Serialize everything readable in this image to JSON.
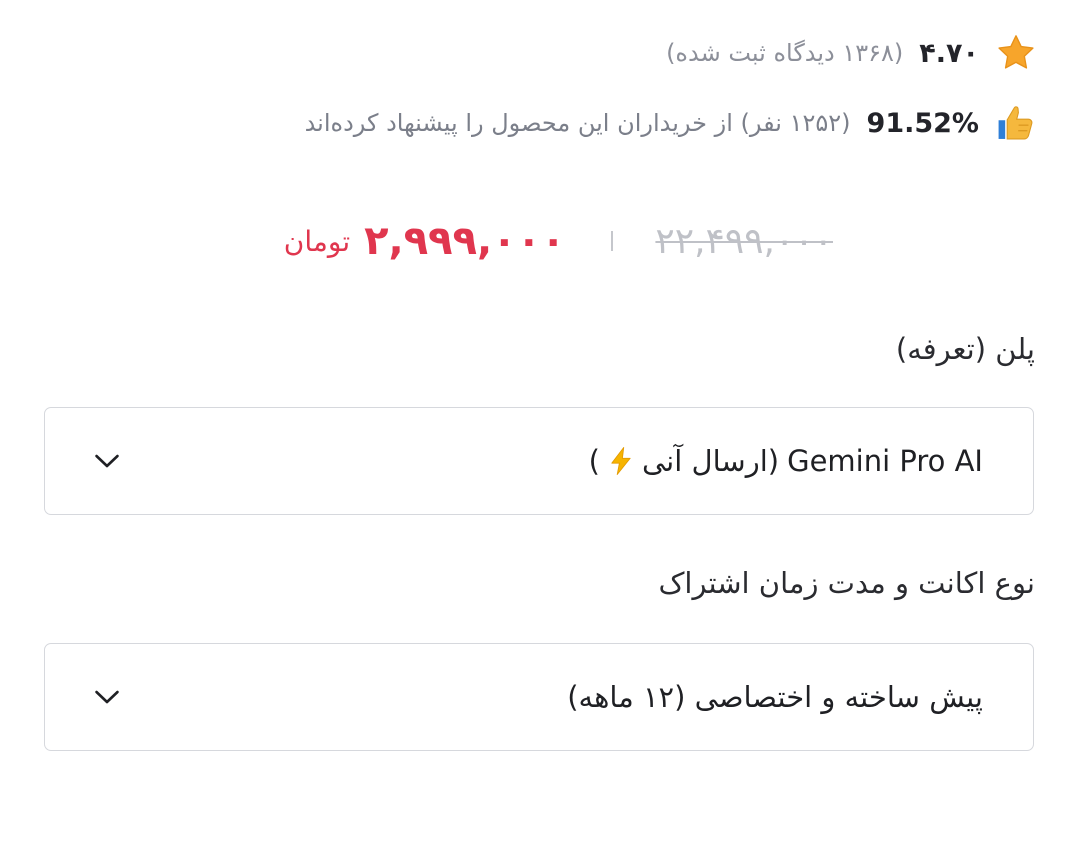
{
  "rating": {
    "value": "۴.۷۰",
    "reviews": "(۱۳۶۸ دیدگاه ثبت شده)",
    "icon": "star-icon"
  },
  "recommendation": {
    "percent": "91.52%",
    "text": "(۱۲۵۲ نفر) از خریداران این محصول را پیشنهاد کرده‌اند",
    "icon": "thumbs-up-icon"
  },
  "price": {
    "old": "۲۲,۴۹۹,۰۰۰",
    "new": "۲,۹۹۹,۰۰۰",
    "currency": "تومان"
  },
  "fields": {
    "plan": {
      "label": "پلن (تعرفه)",
      "value_name": "Gemini Pro AI",
      "value_open": "(ارسال آنی",
      "value_close": ")",
      "value_icon": "lightning-icon"
    },
    "account": {
      "label": "نوع اکانت و مدت زمان اشتراک",
      "value": "پیش ساخته و اختصاصی (۱۲ ماهه)"
    }
  },
  "colors": {
    "price_accent": "#e0364e",
    "star": "#f7a52b",
    "thumb": "#f5b83d"
  }
}
